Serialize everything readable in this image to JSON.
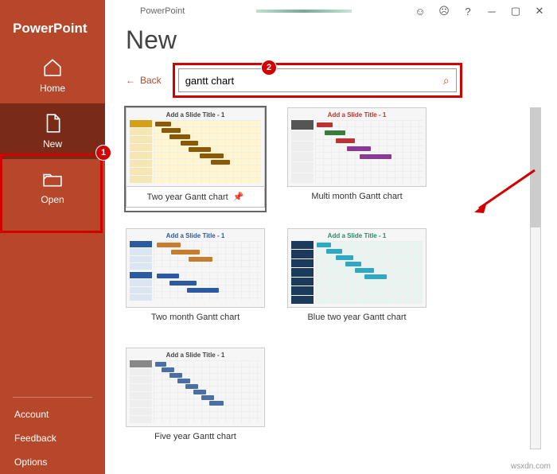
{
  "titlebar": {
    "app_name": "PowerPoint"
  },
  "sidebar": {
    "title": "PowerPoint",
    "items": [
      {
        "label": "Home"
      },
      {
        "label": "New"
      },
      {
        "label": "Open"
      }
    ],
    "footer": [
      {
        "label": "Account"
      },
      {
        "label": "Feedback"
      },
      {
        "label": "Options"
      }
    ]
  },
  "page": {
    "title": "New",
    "back_label": "Back",
    "search_value": "gantt chart"
  },
  "templates": [
    {
      "thumb_title": "Add a Slide Title - 1",
      "label": "Two year Gantt chart"
    },
    {
      "thumb_title": "Add a Slide Title - 1",
      "label": "Multi month Gantt chart"
    },
    {
      "thumb_title": "Add a Slide Title - 1",
      "label": "Two month Gantt chart"
    },
    {
      "thumb_title": "Add a Slide Title - 1",
      "label": "Blue two year Gantt chart"
    },
    {
      "thumb_title": "Add a Slide Title - 1",
      "label": "Five year Gantt chart"
    }
  ],
  "callouts": {
    "one": "1",
    "two": "2"
  },
  "watermark": "wsxdn.com"
}
